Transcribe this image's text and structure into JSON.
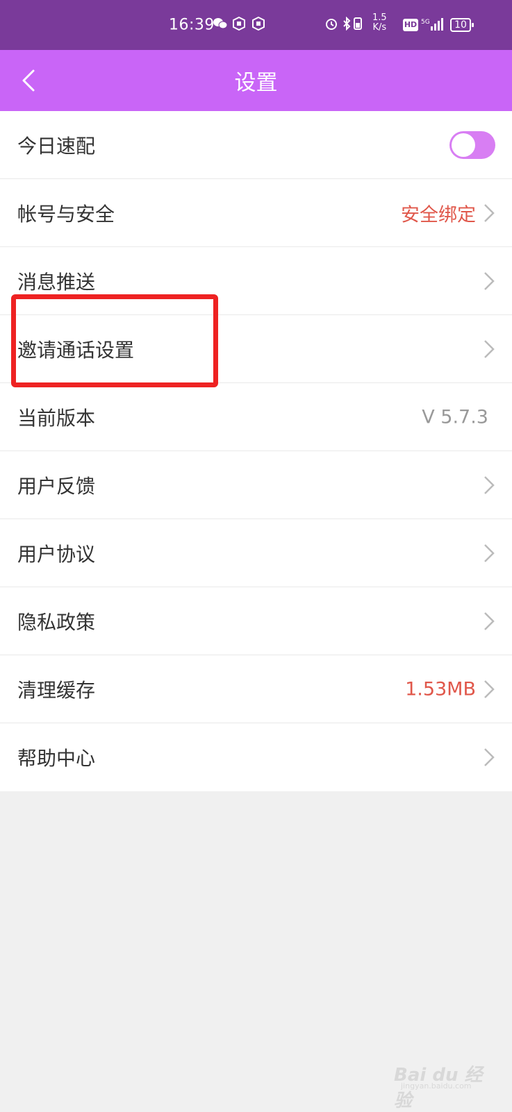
{
  "status_bar": {
    "time": "16:39",
    "net_speed_value": "1.5",
    "net_speed_unit": "K/s",
    "hd_label": "HD",
    "signal_label": "5G",
    "battery": "10"
  },
  "app_bar": {
    "title": "设置",
    "back_icon": "chevron-left-icon"
  },
  "settings": {
    "items": [
      {
        "label": "今日速配",
        "type": "toggle",
        "enabled": false
      },
      {
        "label": "帐号与安全",
        "value": "安全绑定"
      },
      {
        "label": "消息推送"
      },
      {
        "label": "邀请通话设置"
      },
      {
        "label": "当前版本",
        "value": "V 5.7.3"
      },
      {
        "label": "用户反馈"
      },
      {
        "label": "用户协议"
      },
      {
        "label": "隐私政策"
      },
      {
        "label": "清理缓存",
        "value": "1.53MB"
      },
      {
        "label": "帮助中心"
      }
    ]
  },
  "colors": {
    "status_bar_bg": "#7a3a9a",
    "app_bar_bg": "#c965f7",
    "accent_red": "#e0574a",
    "highlight_box": "#ee2222"
  },
  "watermark": {
    "text": "Bai du 经验",
    "sub": "jingyan.baidu.com"
  }
}
